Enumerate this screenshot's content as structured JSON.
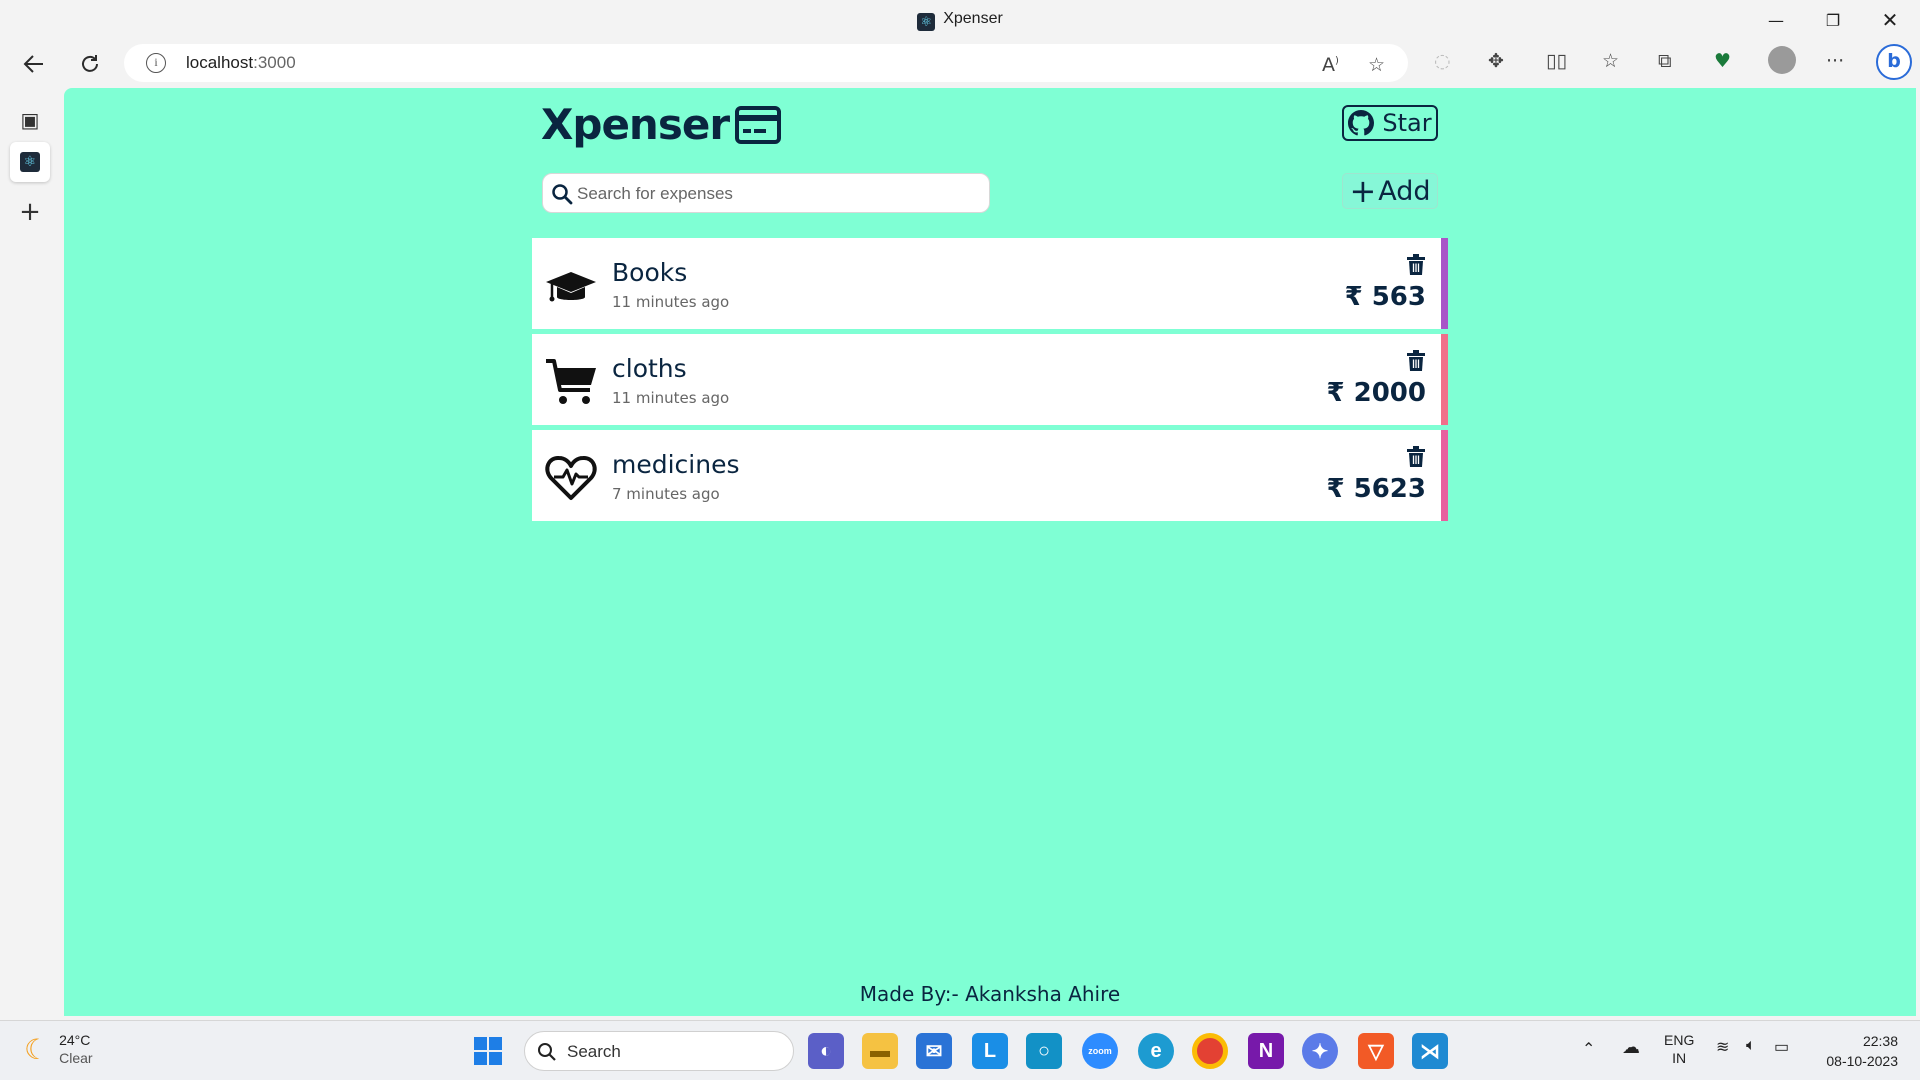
{
  "browser": {
    "tab_title": "Xpenser",
    "url_host": "localhost",
    "url_port": ":3000"
  },
  "app": {
    "logo_text": "Xpenser",
    "star_label": "Star",
    "search_placeholder": "Search for expenses",
    "add_label": "Add",
    "currency": "₹",
    "expenses": [
      {
        "icon": "graduation-cap-icon",
        "name": "Books",
        "time": "11 minutes ago",
        "amount": "₹ 563",
        "accent": "#a855c8"
      },
      {
        "icon": "shopping-cart-icon",
        "name": "cloths",
        "time": "11 minutes ago",
        "amount": "₹ 2000",
        "accent": "#f0708a"
      },
      {
        "icon": "heartbeat-icon",
        "name": "medicines",
        "time": "7 minutes ago",
        "amount": "₹ 5623",
        "accent": "#e8609e"
      }
    ],
    "footer": "Made By:- Akanksha Ahire",
    "background": "#7fffd4",
    "text_color": "#0a2540"
  },
  "taskbar": {
    "weather_temp": "24°C",
    "weather_desc": "Clear",
    "search_label": "Search",
    "lang_top": "ENG",
    "lang_bottom": "IN",
    "time": "22:38",
    "date": "08-10-2023"
  }
}
